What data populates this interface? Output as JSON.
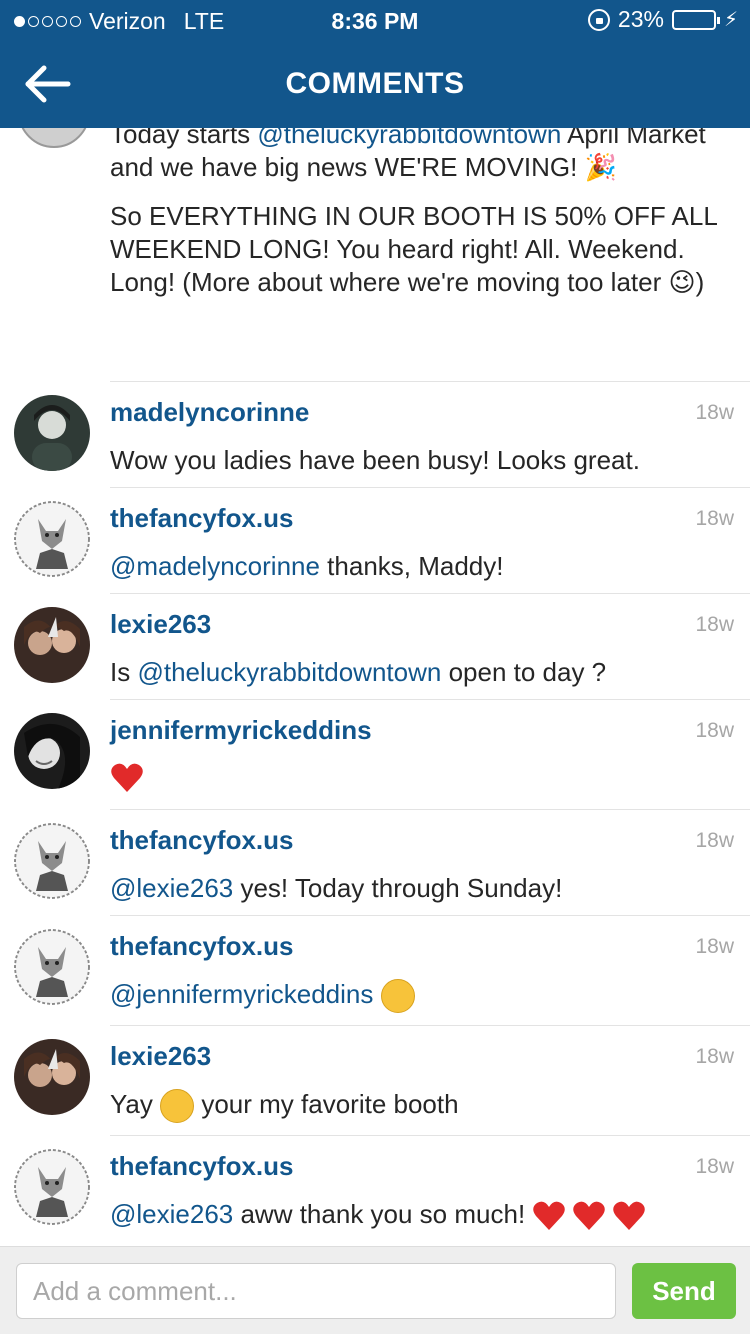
{
  "status_bar": {
    "carrier": "Verizon",
    "network": "LTE",
    "time": "8:36 PM",
    "battery": "23%",
    "battery_level": 0.23
  },
  "header": {
    "title": "COMMENTS"
  },
  "caption": {
    "line1_pre": "Today starts ",
    "line1_mention": "@theluckyrabbitdowntown",
    "line1_post": " April Market and we have big news WE'RE MOVING! 🎉",
    "para2": "So EVERYTHING IN OUR BOOTH IS 50% OFF ALL WEEKEND LONG! You heard right! All. Weekend. Long! (More about where we're moving too later 😉)"
  },
  "comments": [
    {
      "user": "madelyncorinne",
      "time": "18w",
      "text": "Wow you ladies have been busy! Looks great."
    },
    {
      "user": "thefancyfox.us",
      "time": "18w",
      "mention": "@madelyncorinne",
      "text": " thanks, Maddy!"
    },
    {
      "user": "lexie263",
      "time": "18w",
      "pre": "Is ",
      "mention": "@theluckyrabbitdowntown",
      "text": " open to day ?"
    },
    {
      "user": "jennifermyrickeddins",
      "time": "18w",
      "text": ""
    },
    {
      "user": "thefancyfox.us",
      "time": "18w",
      "mention": "@lexie263",
      "text": " yes! Today through Sunday!"
    },
    {
      "user": "thefancyfox.us",
      "time": "18w",
      "mention": "@jennifermyrickeddins",
      "text": ""
    },
    {
      "user": "lexie263",
      "time": "18w",
      "pre": "Yay ",
      "text": " your my favorite booth"
    },
    {
      "user": "thefancyfox.us",
      "time": "18w",
      "mention": "@lexie263",
      "text": " aww thank you so much! "
    }
  ],
  "composer": {
    "placeholder": "Add a comment...",
    "send_label": "Send"
  },
  "colors": {
    "header_bg": "#12568c",
    "link": "#12568c",
    "send_button": "#6cc143"
  }
}
